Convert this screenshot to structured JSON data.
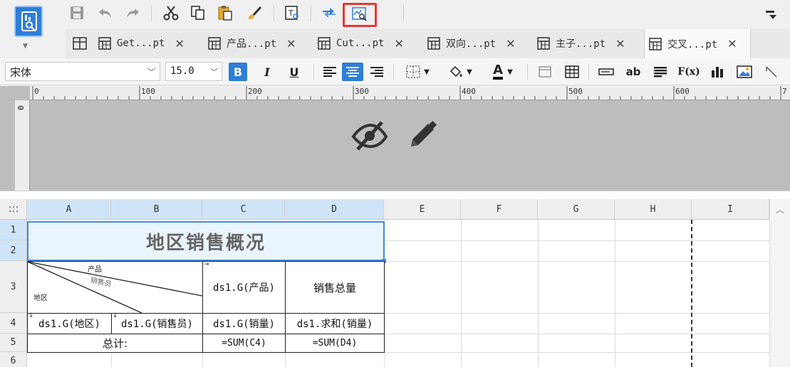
{
  "toolbar": {
    "icons": [
      "app-logo-icon",
      "save-icon",
      "undo-icon",
      "redo-icon",
      "cut-icon",
      "copy-icon",
      "paste-icon",
      "format-painter-icon",
      "text-template-icon",
      "swap-icon",
      "preview-icon"
    ]
  },
  "tabs": [
    {
      "label": "Get...pt"
    },
    {
      "label": "产品...pt"
    },
    {
      "label": "Cut...pt"
    },
    {
      "label": "双向...pt"
    },
    {
      "label": "主子...pt"
    },
    {
      "label": "交叉...pt",
      "active": true
    }
  ],
  "format": {
    "font_family": "宋体",
    "font_size": "15.0",
    "bold_label": "B",
    "italic_label": "I",
    "underline_label": "U",
    "font_color_label": "A",
    "text_tool_label": "ab",
    "formula_label": "F(x)"
  },
  "ruler": {
    "marks": [
      "0",
      "100",
      "200",
      "300",
      "400",
      "500",
      "600",
      "7"
    ],
    "vertical_zero": "0"
  },
  "sheet": {
    "columns": [
      "A",
      "B",
      "C",
      "D",
      "E",
      "F",
      "G",
      "H",
      "I"
    ],
    "rows": [
      "1",
      "2",
      "3",
      "4",
      "5",
      "6"
    ],
    "title": "地区销售概况",
    "slash_header": {
      "product": "产品",
      "salesperson": "销售员",
      "region": "地区"
    },
    "c3": "ds1.G(产品)",
    "d3": "销售总量",
    "a4": "ds1.G(地区)",
    "b4": "ds1.G(销售员)",
    "c4": "ds1.G(销量)",
    "d4": "ds1.求和(销量)",
    "ab5": "总计:",
    "c5": "=SUM(C4)",
    "d5": "=SUM(D4)"
  },
  "colors": {
    "accent": "#2f7ed8",
    "highlight": "#e53935",
    "selection": "#3f8ae0"
  }
}
